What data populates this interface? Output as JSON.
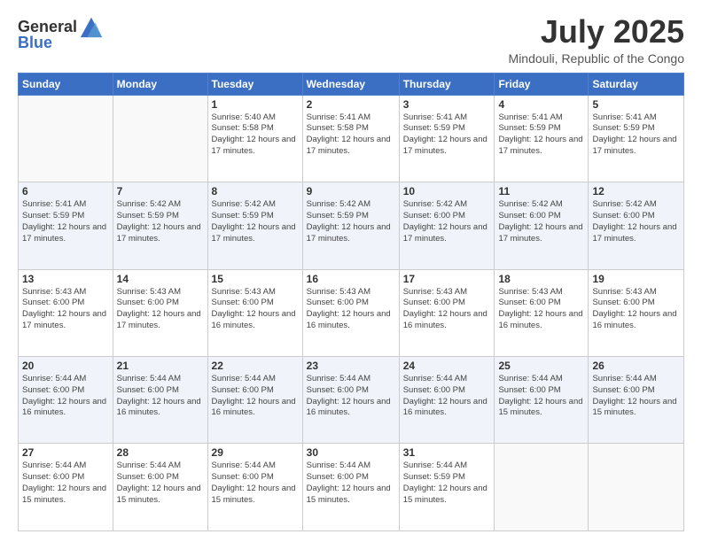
{
  "header": {
    "logo_general": "General",
    "logo_blue": "Blue",
    "month_title": "July 2025",
    "location": "Mindouli, Republic of the Congo"
  },
  "days_of_week": [
    "Sunday",
    "Monday",
    "Tuesday",
    "Wednesday",
    "Thursday",
    "Friday",
    "Saturday"
  ],
  "weeks": [
    [
      {
        "day": "",
        "info": ""
      },
      {
        "day": "",
        "info": ""
      },
      {
        "day": "1",
        "info": "Sunrise: 5:40 AM\nSunset: 5:58 PM\nDaylight: 12 hours and 17 minutes."
      },
      {
        "day": "2",
        "info": "Sunrise: 5:41 AM\nSunset: 5:58 PM\nDaylight: 12 hours and 17 minutes."
      },
      {
        "day": "3",
        "info": "Sunrise: 5:41 AM\nSunset: 5:59 PM\nDaylight: 12 hours and 17 minutes."
      },
      {
        "day": "4",
        "info": "Sunrise: 5:41 AM\nSunset: 5:59 PM\nDaylight: 12 hours and 17 minutes."
      },
      {
        "day": "5",
        "info": "Sunrise: 5:41 AM\nSunset: 5:59 PM\nDaylight: 12 hours and 17 minutes."
      }
    ],
    [
      {
        "day": "6",
        "info": "Sunrise: 5:41 AM\nSunset: 5:59 PM\nDaylight: 12 hours and 17 minutes."
      },
      {
        "day": "7",
        "info": "Sunrise: 5:42 AM\nSunset: 5:59 PM\nDaylight: 12 hours and 17 minutes."
      },
      {
        "day": "8",
        "info": "Sunrise: 5:42 AM\nSunset: 5:59 PM\nDaylight: 12 hours and 17 minutes."
      },
      {
        "day": "9",
        "info": "Sunrise: 5:42 AM\nSunset: 5:59 PM\nDaylight: 12 hours and 17 minutes."
      },
      {
        "day": "10",
        "info": "Sunrise: 5:42 AM\nSunset: 6:00 PM\nDaylight: 12 hours and 17 minutes."
      },
      {
        "day": "11",
        "info": "Sunrise: 5:42 AM\nSunset: 6:00 PM\nDaylight: 12 hours and 17 minutes."
      },
      {
        "day": "12",
        "info": "Sunrise: 5:42 AM\nSunset: 6:00 PM\nDaylight: 12 hours and 17 minutes."
      }
    ],
    [
      {
        "day": "13",
        "info": "Sunrise: 5:43 AM\nSunset: 6:00 PM\nDaylight: 12 hours and 17 minutes."
      },
      {
        "day": "14",
        "info": "Sunrise: 5:43 AM\nSunset: 6:00 PM\nDaylight: 12 hours and 17 minutes."
      },
      {
        "day": "15",
        "info": "Sunrise: 5:43 AM\nSunset: 6:00 PM\nDaylight: 12 hours and 16 minutes."
      },
      {
        "day": "16",
        "info": "Sunrise: 5:43 AM\nSunset: 6:00 PM\nDaylight: 12 hours and 16 minutes."
      },
      {
        "day": "17",
        "info": "Sunrise: 5:43 AM\nSunset: 6:00 PM\nDaylight: 12 hours and 16 minutes."
      },
      {
        "day": "18",
        "info": "Sunrise: 5:43 AM\nSunset: 6:00 PM\nDaylight: 12 hours and 16 minutes."
      },
      {
        "day": "19",
        "info": "Sunrise: 5:43 AM\nSunset: 6:00 PM\nDaylight: 12 hours and 16 minutes."
      }
    ],
    [
      {
        "day": "20",
        "info": "Sunrise: 5:44 AM\nSunset: 6:00 PM\nDaylight: 12 hours and 16 minutes."
      },
      {
        "day": "21",
        "info": "Sunrise: 5:44 AM\nSunset: 6:00 PM\nDaylight: 12 hours and 16 minutes."
      },
      {
        "day": "22",
        "info": "Sunrise: 5:44 AM\nSunset: 6:00 PM\nDaylight: 12 hours and 16 minutes."
      },
      {
        "day": "23",
        "info": "Sunrise: 5:44 AM\nSunset: 6:00 PM\nDaylight: 12 hours and 16 minutes."
      },
      {
        "day": "24",
        "info": "Sunrise: 5:44 AM\nSunset: 6:00 PM\nDaylight: 12 hours and 16 minutes."
      },
      {
        "day": "25",
        "info": "Sunrise: 5:44 AM\nSunset: 6:00 PM\nDaylight: 12 hours and 15 minutes."
      },
      {
        "day": "26",
        "info": "Sunrise: 5:44 AM\nSunset: 6:00 PM\nDaylight: 12 hours and 15 minutes."
      }
    ],
    [
      {
        "day": "27",
        "info": "Sunrise: 5:44 AM\nSunset: 6:00 PM\nDaylight: 12 hours and 15 minutes."
      },
      {
        "day": "28",
        "info": "Sunrise: 5:44 AM\nSunset: 6:00 PM\nDaylight: 12 hours and 15 minutes."
      },
      {
        "day": "29",
        "info": "Sunrise: 5:44 AM\nSunset: 6:00 PM\nDaylight: 12 hours and 15 minutes."
      },
      {
        "day": "30",
        "info": "Sunrise: 5:44 AM\nSunset: 6:00 PM\nDaylight: 12 hours and 15 minutes."
      },
      {
        "day": "31",
        "info": "Sunrise: 5:44 AM\nSunset: 5:59 PM\nDaylight: 12 hours and 15 minutes."
      },
      {
        "day": "",
        "info": ""
      },
      {
        "day": "",
        "info": ""
      }
    ]
  ]
}
